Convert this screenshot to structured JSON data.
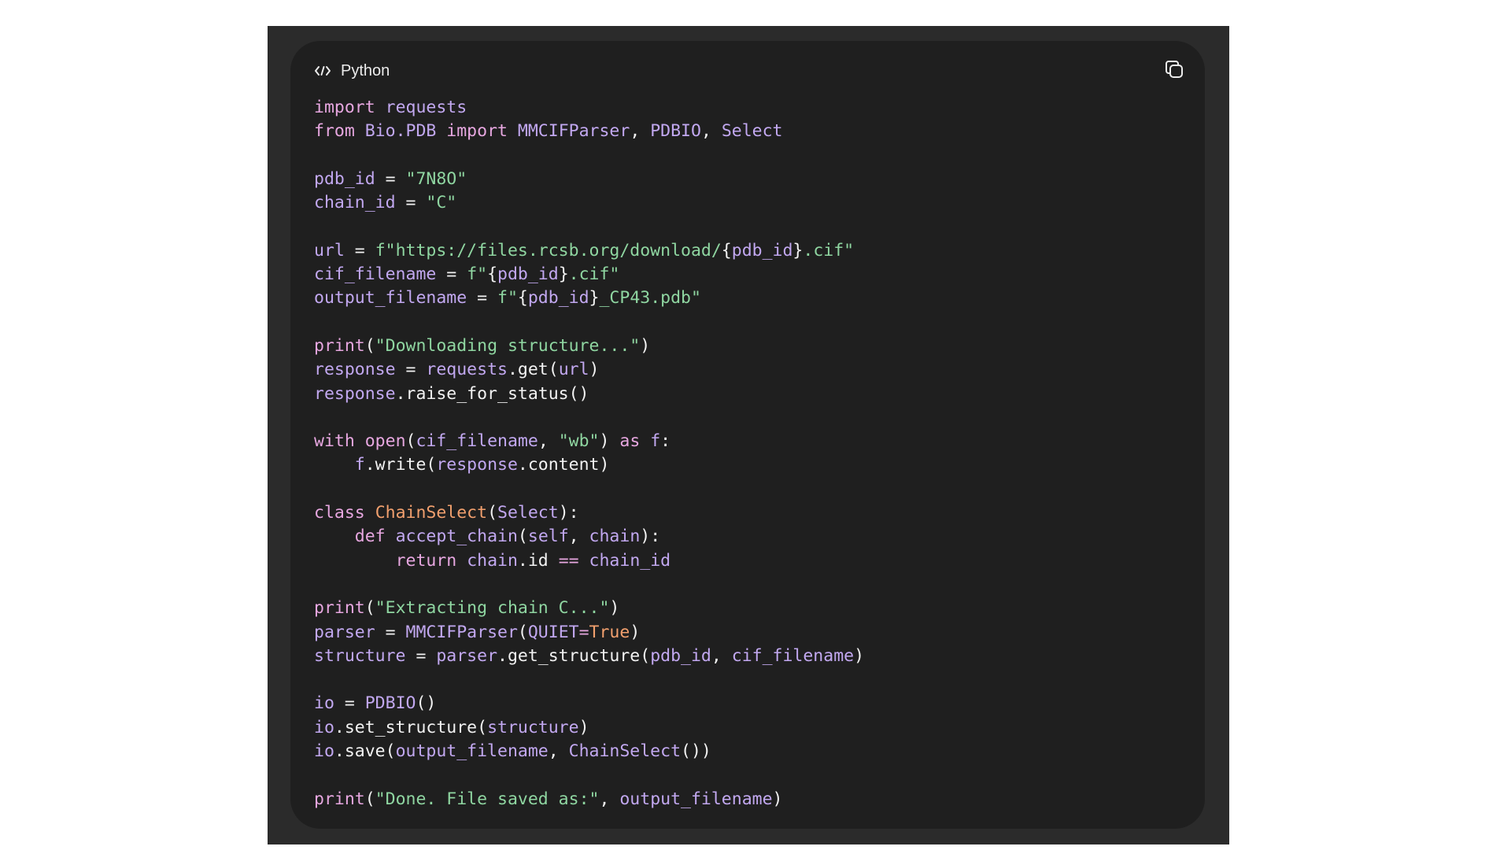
{
  "code_block": {
    "language": "Python",
    "icons": {
      "language": "code-icon",
      "copy": "copy-icon"
    },
    "lines": [
      [
        {
          "t": "import",
          "c": "kw"
        },
        {
          "t": " ",
          "c": "pl"
        },
        {
          "t": "requests",
          "c": "nm"
        }
      ],
      [
        {
          "t": "from",
          "c": "kw"
        },
        {
          "t": " ",
          "c": "pl"
        },
        {
          "t": "Bio.PDB",
          "c": "nm"
        },
        {
          "t": " ",
          "c": "pl"
        },
        {
          "t": "import",
          "c": "kw"
        },
        {
          "t": " ",
          "c": "pl"
        },
        {
          "t": "MMCIFParser",
          "c": "nm"
        },
        {
          "t": ", ",
          "c": "pl"
        },
        {
          "t": "PDBIO",
          "c": "nm"
        },
        {
          "t": ", ",
          "c": "pl"
        },
        {
          "t": "Select",
          "c": "nm"
        }
      ],
      [],
      [
        {
          "t": "pdb_id",
          "c": "nm"
        },
        {
          "t": " = ",
          "c": "pl"
        },
        {
          "t": "\"7N8O\"",
          "c": "str"
        }
      ],
      [
        {
          "t": "chain_id",
          "c": "nm"
        },
        {
          "t": " = ",
          "c": "pl"
        },
        {
          "t": "\"C\"",
          "c": "str"
        }
      ],
      [],
      [
        {
          "t": "url",
          "c": "nm"
        },
        {
          "t": " = ",
          "c": "pl"
        },
        {
          "t": "f\"https://files.rcsb.org/download/",
          "c": "str"
        },
        {
          "t": "{",
          "c": "pl"
        },
        {
          "t": "pdb_id",
          "c": "nm"
        },
        {
          "t": "}",
          "c": "pl"
        },
        {
          "t": ".cif\"",
          "c": "str"
        }
      ],
      [
        {
          "t": "cif_filename",
          "c": "nm"
        },
        {
          "t": " = ",
          "c": "pl"
        },
        {
          "t": "f\"",
          "c": "str"
        },
        {
          "t": "{",
          "c": "pl"
        },
        {
          "t": "pdb_id",
          "c": "nm"
        },
        {
          "t": "}",
          "c": "pl"
        },
        {
          "t": ".cif\"",
          "c": "str"
        }
      ],
      [
        {
          "t": "output_filename",
          "c": "nm"
        },
        {
          "t": " = ",
          "c": "pl"
        },
        {
          "t": "f\"",
          "c": "str"
        },
        {
          "t": "{",
          "c": "pl"
        },
        {
          "t": "pdb_id",
          "c": "nm"
        },
        {
          "t": "}",
          "c": "pl"
        },
        {
          "t": "_CP43.pdb\"",
          "c": "str"
        }
      ],
      [],
      [
        {
          "t": "print",
          "c": "kw"
        },
        {
          "t": "(",
          "c": "pl"
        },
        {
          "t": "\"Downloading structure...\"",
          "c": "str"
        },
        {
          "t": ")",
          "c": "pl"
        }
      ],
      [
        {
          "t": "response",
          "c": "nm"
        },
        {
          "t": " = ",
          "c": "pl"
        },
        {
          "t": "requests",
          "c": "nm"
        },
        {
          "t": ".get(",
          "c": "pl"
        },
        {
          "t": "url",
          "c": "nm"
        },
        {
          "t": ")",
          "c": "pl"
        }
      ],
      [
        {
          "t": "response",
          "c": "nm"
        },
        {
          "t": ".raise_for_status()",
          "c": "pl"
        }
      ],
      [],
      [
        {
          "t": "with",
          "c": "kw"
        },
        {
          "t": " ",
          "c": "pl"
        },
        {
          "t": "open",
          "c": "kw"
        },
        {
          "t": "(",
          "c": "pl"
        },
        {
          "t": "cif_filename",
          "c": "nm"
        },
        {
          "t": ", ",
          "c": "pl"
        },
        {
          "t": "\"wb\"",
          "c": "str"
        },
        {
          "t": ") ",
          "c": "pl"
        },
        {
          "t": "as",
          "c": "kw"
        },
        {
          "t": " ",
          "c": "pl"
        },
        {
          "t": "f",
          "c": "nm"
        },
        {
          "t": ":",
          "c": "pl"
        }
      ],
      [
        {
          "t": "    ",
          "c": "pl"
        },
        {
          "t": "f",
          "c": "nm"
        },
        {
          "t": ".write(",
          "c": "pl"
        },
        {
          "t": "response",
          "c": "nm"
        },
        {
          "t": ".content)",
          "c": "pl"
        }
      ],
      [],
      [
        {
          "t": "class",
          "c": "kw"
        },
        {
          "t": " ",
          "c": "pl"
        },
        {
          "t": "ChainSelect",
          "c": "cls"
        },
        {
          "t": "(",
          "c": "pl"
        },
        {
          "t": "Select",
          "c": "nm"
        },
        {
          "t": "):",
          "c": "pl"
        }
      ],
      [
        {
          "t": "    ",
          "c": "pl"
        },
        {
          "t": "def",
          "c": "kw"
        },
        {
          "t": " ",
          "c": "pl"
        },
        {
          "t": "accept_chain",
          "c": "nm"
        },
        {
          "t": "(",
          "c": "pl"
        },
        {
          "t": "self",
          "c": "nm"
        },
        {
          "t": ", ",
          "c": "pl"
        },
        {
          "t": "chain",
          "c": "nm"
        },
        {
          "t": "):",
          "c": "pl"
        }
      ],
      [
        {
          "t": "        ",
          "c": "pl"
        },
        {
          "t": "return",
          "c": "kw"
        },
        {
          "t": " ",
          "c": "pl"
        },
        {
          "t": "chain",
          "c": "nm"
        },
        {
          "t": ".id ",
          "c": "pl"
        },
        {
          "t": "==",
          "c": "kw"
        },
        {
          "t": " ",
          "c": "pl"
        },
        {
          "t": "chain_id",
          "c": "nm"
        }
      ],
      [],
      [
        {
          "t": "print",
          "c": "kw"
        },
        {
          "t": "(",
          "c": "pl"
        },
        {
          "t": "\"Extracting chain C...\"",
          "c": "str"
        },
        {
          "t": ")",
          "c": "pl"
        }
      ],
      [
        {
          "t": "parser",
          "c": "nm"
        },
        {
          "t": " = ",
          "c": "pl"
        },
        {
          "t": "MMCIFParser",
          "c": "nm"
        },
        {
          "t": "(",
          "c": "pl"
        },
        {
          "t": "QUIET",
          "c": "nm"
        },
        {
          "t": "=",
          "c": "kw"
        },
        {
          "t": "True",
          "c": "cls"
        },
        {
          "t": ")",
          "c": "pl"
        }
      ],
      [
        {
          "t": "structure",
          "c": "nm"
        },
        {
          "t": " = ",
          "c": "pl"
        },
        {
          "t": "parser",
          "c": "nm"
        },
        {
          "t": ".get_structure(",
          "c": "pl"
        },
        {
          "t": "pdb_id",
          "c": "nm"
        },
        {
          "t": ", ",
          "c": "pl"
        },
        {
          "t": "cif_filename",
          "c": "nm"
        },
        {
          "t": ")",
          "c": "pl"
        }
      ],
      [],
      [
        {
          "t": "io",
          "c": "nm"
        },
        {
          "t": " = ",
          "c": "pl"
        },
        {
          "t": "PDBIO",
          "c": "nm"
        },
        {
          "t": "()",
          "c": "pl"
        }
      ],
      [
        {
          "t": "io",
          "c": "nm"
        },
        {
          "t": ".set_structure(",
          "c": "pl"
        },
        {
          "t": "structure",
          "c": "nm"
        },
        {
          "t": ")",
          "c": "pl"
        }
      ],
      [
        {
          "t": "io",
          "c": "nm"
        },
        {
          "t": ".save(",
          "c": "pl"
        },
        {
          "t": "output_filename",
          "c": "nm"
        },
        {
          "t": ", ",
          "c": "pl"
        },
        {
          "t": "ChainSelect",
          "c": "nm"
        },
        {
          "t": "())",
          "c": "pl"
        }
      ],
      [],
      [
        {
          "t": "print",
          "c": "kw"
        },
        {
          "t": "(",
          "c": "pl"
        },
        {
          "t": "\"Done. File saved as:\"",
          "c": "str"
        },
        {
          "t": ", ",
          "c": "pl"
        },
        {
          "t": "output_filename",
          "c": "nm"
        },
        {
          "t": ")",
          "c": "pl"
        }
      ]
    ]
  },
  "colors": {
    "keyword": "#e7a7e0",
    "name": "#c2a8f0",
    "string": "#8fd6a1",
    "class_or_constant": "#f2a06e",
    "plain": "#f2f2f2",
    "card_background": "#1f1f1f",
    "frame_background": "#2b2b2b"
  }
}
